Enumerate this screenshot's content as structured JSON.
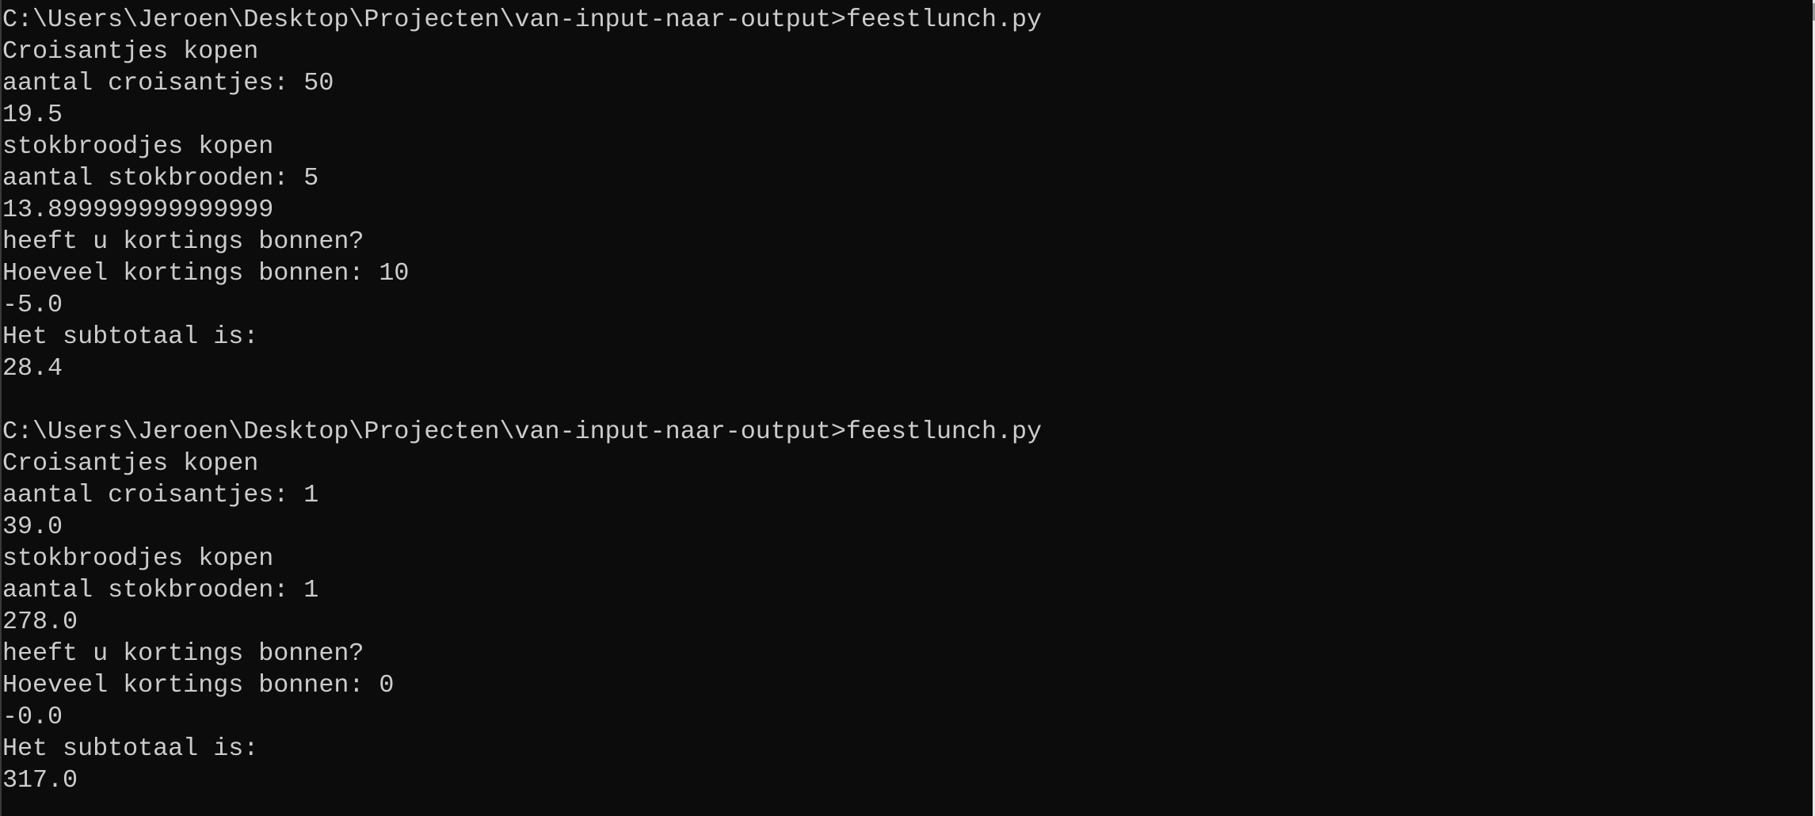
{
  "terminal": {
    "colors": {
      "background": "#0c0c0c",
      "text": "#cccccc"
    },
    "lines": [
      "C:\\Users\\Jeroen\\Desktop\\Projecten\\van-input-naar-output>feestlunch.py",
      "Croisantjes kopen",
      "aantal croisantjes: 50",
      "19.5",
      "stokbroodjes kopen",
      "aantal stokbrooden: 5",
      "13.899999999999999",
      "heeft u kortings bonnen?",
      "Hoeveel kortings bonnen: 10",
      "-5.0",
      "Het subtotaal is:",
      "28.4",
      "",
      "C:\\Users\\Jeroen\\Desktop\\Projecten\\van-input-naar-output>feestlunch.py",
      "Croisantjes kopen",
      "aantal croisantjes: 1",
      "39.0",
      "stokbroodjes kopen",
      "aantal stokbrooden: 1",
      "278.0",
      "heeft u kortings bonnen?",
      "Hoeveel kortings bonnen: 0",
      "-0.0",
      "Het subtotaal is:",
      "317.0"
    ]
  }
}
